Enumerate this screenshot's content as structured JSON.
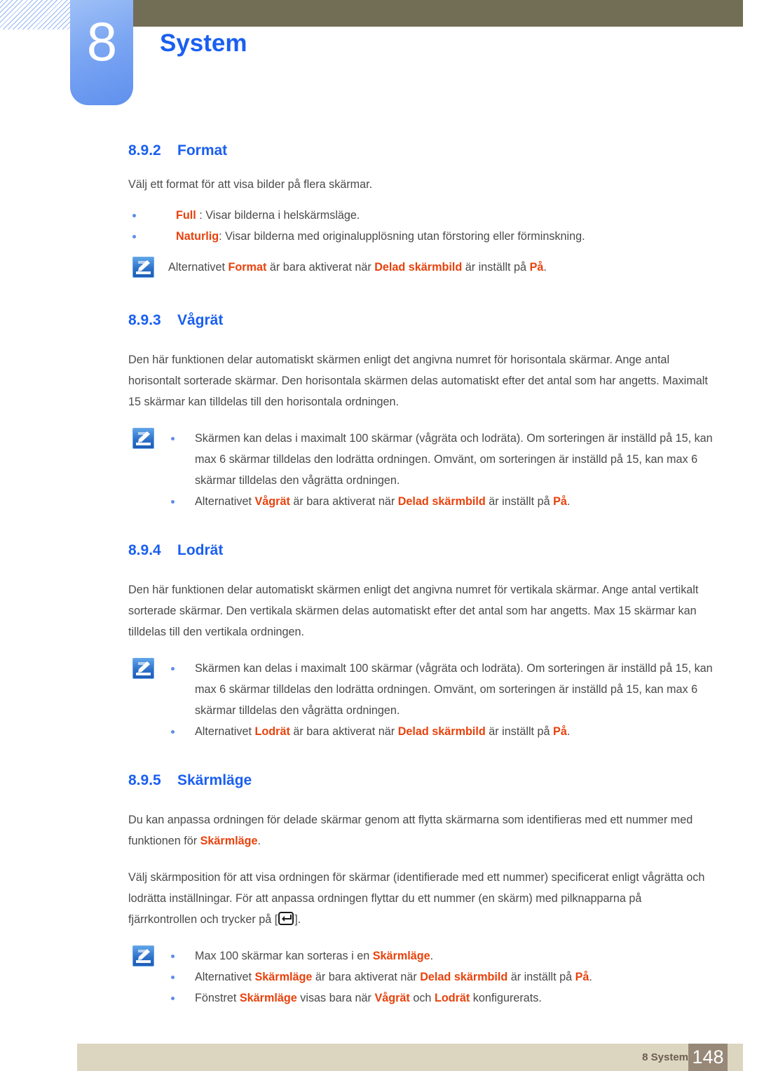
{
  "header": {
    "chapter_number": "8",
    "chapter_title": "System",
    "title_color": "#1a5ff0",
    "bar_color": "#726e56",
    "badge_color": "#7ba6f2"
  },
  "sections": [
    {
      "number": "8.9.2",
      "title": "Format",
      "intro": "Välj ett format för att visa bilder på flera skärmar.",
      "options": [
        {
          "keyword": "Full",
          "sep": " : ",
          "text": "Visar bilderna i helskärmsläge."
        },
        {
          "keyword": "Naturlig",
          "sep": ": ",
          "text": "Visar bilderna med originalupplösning utan förstoring eller förminskning."
        }
      ],
      "note": {
        "icon": "note-pencil-icon",
        "lines": [
          {
            "parts": [
              {
                "t": "Alternativet ",
                "kw": false
              },
              {
                "t": "Format",
                "kw": true
              },
              {
                "t": " är bara aktiverat när ",
                "kw": false
              },
              {
                "t": "Delad skärmbild",
                "kw": true
              },
              {
                "t": " är inställt på ",
                "kw": false
              },
              {
                "t": "På",
                "kw": true
              },
              {
                "t": ".",
                "kw": false
              }
            ]
          }
        ]
      }
    },
    {
      "number": "8.9.3",
      "title": "Vågrät",
      "body": "Den här funktionen delar automatiskt skärmen enligt det angivna numret för horisontala skärmar. Ange antal horisontalt sorterade skärmar. Den horisontala skärmen delas automatiskt efter det antal som har angetts. Maximalt 15 skärmar kan tilldelas till den horisontala ordningen.",
      "note": {
        "icon": "note-pencil-icon",
        "bullets": [
          {
            "parts": [
              {
                "t": "Skärmen kan delas i maximalt 100 skärmar (vågräta och lodräta). Om sorteringen är inställd på 15, kan max 6 skärmar tilldelas den lodrätta ordningen. Omvänt, om sorteringen är inställd på 15, kan max 6 skärmar tilldelas den vågrätta ordningen.",
                "kw": false
              }
            ]
          },
          {
            "parts": [
              {
                "t": "Alternativet ",
                "kw": false
              },
              {
                "t": "Vågrät",
                "kw": true
              },
              {
                "t": " är bara aktiverat när ",
                "kw": false
              },
              {
                "t": "Delad skärmbild",
                "kw": true
              },
              {
                "t": " är inställt på ",
                "kw": false
              },
              {
                "t": "På",
                "kw": true
              },
              {
                "t": ".",
                "kw": false
              }
            ]
          }
        ]
      }
    },
    {
      "number": "8.9.4",
      "title": "Lodrät",
      "body": "Den här funktionen delar automatiskt skärmen enligt det angivna numret för vertikala skärmar. Ange antal vertikalt sorterade skärmar. Den vertikala skärmen delas automatiskt efter det antal som har angetts. Max 15 skärmar kan tilldelas till den vertikala ordningen.",
      "note": {
        "icon": "note-pencil-icon",
        "bullets": [
          {
            "parts": [
              {
                "t": "Skärmen kan delas i maximalt 100 skärmar (vågräta och lodräta). Om sorteringen är inställd på 15, kan max 6 skärmar tilldelas den lodrätta ordningen. Omvänt, om sorteringen är inställd på 15, kan max 6 skärmar tilldelas den vågrätta ordningen.",
                "kw": false
              }
            ]
          },
          {
            "parts": [
              {
                "t": "Alternativet ",
                "kw": false
              },
              {
                "t": "Lodrät",
                "kw": true
              },
              {
                "t": " är bara aktiverat när ",
                "kw": false
              },
              {
                "t": "Delad skärmbild",
                "kw": true
              },
              {
                "t": " är inställt på ",
                "kw": false
              },
              {
                "t": "På",
                "kw": true
              },
              {
                "t": ".",
                "kw": false
              }
            ]
          }
        ]
      }
    },
    {
      "number": "8.9.5",
      "title": "Skärmläge",
      "para1_parts": [
        {
          "t": "Du kan anpassa ordningen för delade skärmar genom att flytta skärmarna som identifieras med ett nummer med funktionen för ",
          "kw": false
        },
        {
          "t": "Skärmläge",
          "kw": true
        },
        {
          "t": ".",
          "kw": false
        }
      ],
      "para2_pre": "Välj skärmposition för att visa ordningen för skärmar (identifierade med ett nummer) specificerat enligt vågrätta och lodrätta inställningar. För att anpassa ordningen flyttar du ett nummer (en skärm) med pilknapparna på fjärrkontrollen och trycker på [",
      "para2_post": "].",
      "enter_key_icon": "enter-key-icon",
      "note": {
        "icon": "note-pencil-icon",
        "bullets": [
          {
            "parts": [
              {
                "t": "Max 100 skärmar kan sorteras i en ",
                "kw": false
              },
              {
                "t": "Skärmläge",
                "kw": true
              },
              {
                "t": ".",
                "kw": false
              }
            ]
          },
          {
            "parts": [
              {
                "t": "Alternativet ",
                "kw": false
              },
              {
                "t": "Skärmläge",
                "kw": true
              },
              {
                "t": " är bara aktiverat när ",
                "kw": false
              },
              {
                "t": "Delad skärmbild",
                "kw": true
              },
              {
                "t": " är inställt på ",
                "kw": false
              },
              {
                "t": "På",
                "kw": true
              },
              {
                "t": ".",
                "kw": false
              }
            ]
          },
          {
            "parts": [
              {
                "t": "Fönstret ",
                "kw": false
              },
              {
                "t": "Skärmläge",
                "kw": true
              },
              {
                "t": " visas bara när ",
                "kw": false
              },
              {
                "t": "Vågrät",
                "kw": true
              },
              {
                "t": " och ",
                "kw": false
              },
              {
                "t": "Lodrät",
                "kw": true
              },
              {
                "t": " konfigurerats.",
                "kw": false
              }
            ]
          }
        ]
      }
    }
  ],
  "footer": {
    "label": "8 System",
    "page_number": "148",
    "bar_color": "#dcd6c0",
    "page_box_color": "#978878"
  }
}
